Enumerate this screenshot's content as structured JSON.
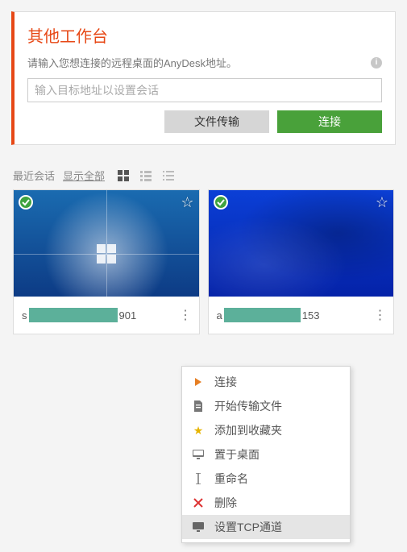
{
  "panel": {
    "title": "其他工作台",
    "desc": "请输入您想连接的远程桌面的AnyDesk地址。",
    "placeholder": "输入目标地址以设置会话",
    "file_transfer_btn": "文件传输",
    "connect_btn": "连接"
  },
  "recent": {
    "label": "最近会话",
    "show_all": "显示全部"
  },
  "cards": [
    {
      "prefix": "s",
      "suffix": "901"
    },
    {
      "prefix": "a",
      "suffix": "153"
    }
  ],
  "menu": {
    "connect": "连接",
    "start_transfer": "开始传输文件",
    "add_fav": "添加到收藏夹",
    "desktop": "置于桌面",
    "rename": "重命名",
    "delete": "删除",
    "tcp": "设置TCP通道"
  }
}
